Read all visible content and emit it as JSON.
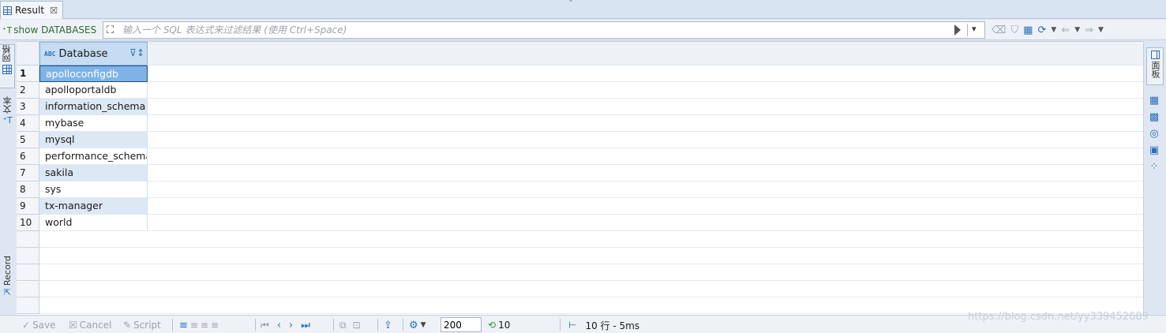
{
  "tab": {
    "title": "Result",
    "close_glyph": "☒"
  },
  "query": {
    "label": "show DATABASES",
    "icon": "sql-run-icon"
  },
  "filter": {
    "placeholder": "输入一个 SQL 表达式来过滤结果 (使用 Ctrl+Space)"
  },
  "left_tabs": {
    "grid": "网格",
    "text": "文本",
    "record": "Record"
  },
  "right_tabs": {
    "panels": "面板"
  },
  "grid": {
    "column": {
      "name": "Database",
      "type_badge": "ABC"
    },
    "rows": [
      {
        "num": "1",
        "value": "apolloconfigdb"
      },
      {
        "num": "2",
        "value": "apolloportaldb"
      },
      {
        "num": "3",
        "value": "information_schema"
      },
      {
        "num": "4",
        "value": "mybase"
      },
      {
        "num": "5",
        "value": "mysql"
      },
      {
        "num": "6",
        "value": "performance_schema"
      },
      {
        "num": "7",
        "value": "sakila"
      },
      {
        "num": "8",
        "value": "sys"
      },
      {
        "num": "9",
        "value": "tx-manager"
      },
      {
        "num": "10",
        "value": "world"
      }
    ],
    "selected_row": "1"
  },
  "bottom": {
    "save": "Save",
    "cancel": "Cancel",
    "script": "Script",
    "fetch_size": "200",
    "row_count": "10",
    "status": "10 行 - 5ms"
  },
  "watermark": "https://blog.csdn.net/yy339452689",
  "colors": {
    "accent": "#2a6fb8",
    "selection": "#7fb3e8",
    "alt_row": "#dde8f5",
    "background": "#dde6f1"
  }
}
